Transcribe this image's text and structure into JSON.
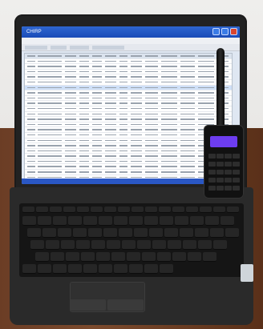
{
  "scene": {
    "description_tag": "photo-of-laptop-and-handheld-radio",
    "colors": {
      "wall": "#efeeec",
      "table": "#6b3d25",
      "laptop": "#222222",
      "window_title": "#1a4bb8",
      "radio_lcd": "#6d3df0"
    }
  },
  "screen": {
    "window_title": "CHIRP"
  }
}
